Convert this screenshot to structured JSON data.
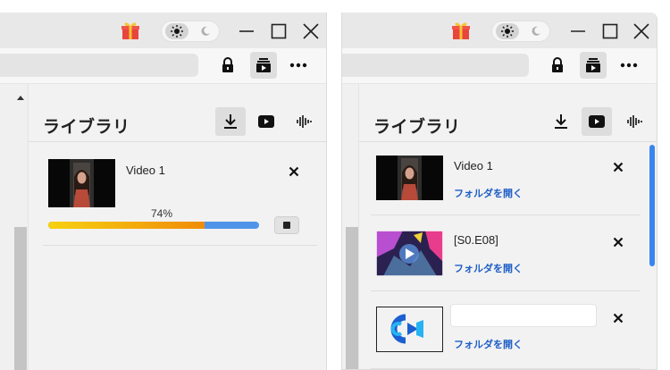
{
  "windows": [
    {
      "panel": {
        "title": "ライブラリ",
        "active_tab": "download"
      },
      "items": [
        {
          "title": "Video 1",
          "progress_label": "74%",
          "progress": 0.74
        }
      ]
    },
    {
      "panel": {
        "title": "ライブラリ",
        "active_tab": "youtube"
      },
      "items": [
        {
          "title": "Video 1",
          "open_folder": "フォルダを開く"
        },
        {
          "title": "[S0.E08]",
          "open_folder": "フォルダを開く"
        },
        {
          "title": "",
          "open_folder": "フォルダを開く"
        }
      ]
    }
  ],
  "icons": {
    "gift": "gift-icon",
    "theme_light": "sun-icon",
    "theme_dark": "moon-icon",
    "lock": "lock-icon",
    "media": "media-player-icon",
    "more": "more-icon",
    "download": "download-icon",
    "youtube": "youtube-play-icon",
    "audio": "audio-waveform-icon",
    "close": "close-icon",
    "stop": "stop-icon"
  },
  "colors": {
    "accent_blue": "#1f5fc6",
    "progress_start": "#f7d10f",
    "progress_end": "#f08c08",
    "progress_track": "#4f94e8",
    "scrollbar": "#3a86f0"
  }
}
